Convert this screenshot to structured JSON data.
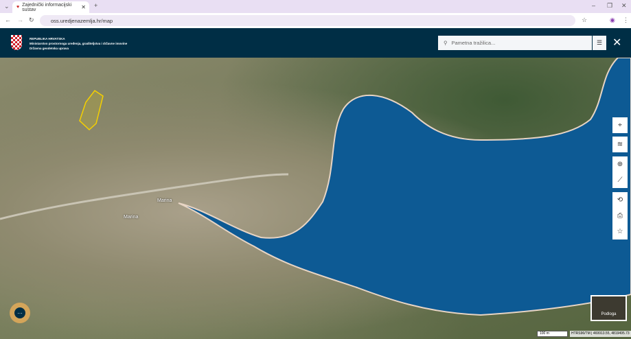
{
  "browser": {
    "tab_title": "Zajednički informacijski sustav",
    "url": "oss.uredjenazemlja.hr/map"
  },
  "header": {
    "line1": "REPUBLIKA HRVATSKA",
    "line2": "Ministarstvo prostornoga uređenja, graditeljstva i državne imovine",
    "line3": "Državna geodetska uprava",
    "search_placeholder": "Pametna tražilica..."
  },
  "map": {
    "labels": [
      "Marina",
      "Marina"
    ],
    "basemap_label": "Podloga",
    "scale": "100 m",
    "coords": "HTRS96/TM | 469913.55, 4819495.73",
    "sea_color": "#0d5a94"
  }
}
